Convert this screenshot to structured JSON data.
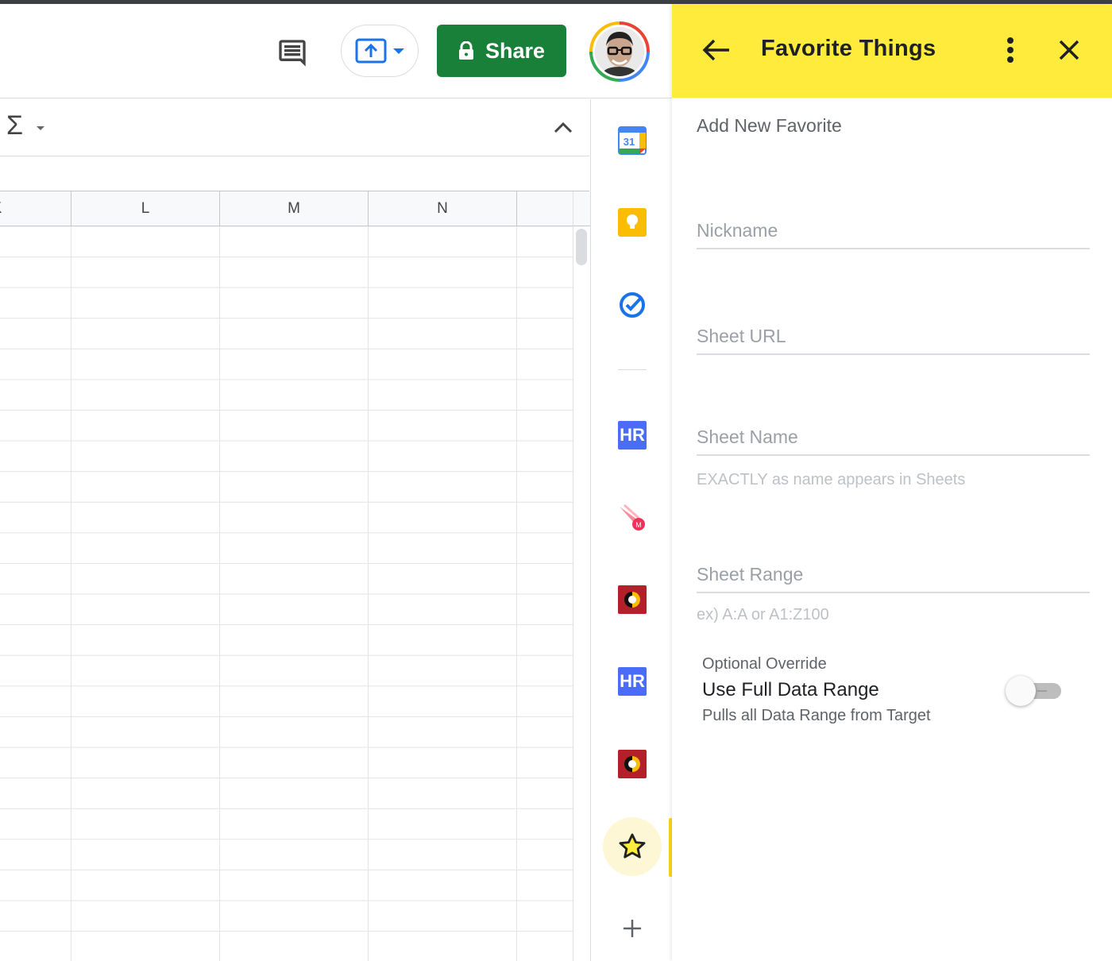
{
  "header": {
    "share_label": "Share",
    "share_color": "#188038"
  },
  "grid": {
    "columns": [
      "K",
      "L",
      "M",
      "N"
    ]
  },
  "rail": {
    "items": [
      {
        "icon": "calendar-icon",
        "text": "31"
      },
      {
        "icon": "keep-icon"
      },
      {
        "icon": "tasks-icon"
      },
      {
        "icon": "hr-addon-icon",
        "text": "HR"
      },
      {
        "icon": "meteor-addon-icon"
      },
      {
        "icon": "red-addon-icon"
      },
      {
        "icon": "hr-addon-icon",
        "text": "HR"
      },
      {
        "icon": "red-addon-icon"
      },
      {
        "icon": "star-icon",
        "active": true
      },
      {
        "icon": "plus-icon"
      }
    ]
  },
  "panel": {
    "title": "Favorite Things",
    "header_color": "#ffeb3b",
    "section_title": "Add New Favorite",
    "fields": {
      "nickname_placeholder": "Nickname",
      "sheet_url_placeholder": "Sheet URL",
      "sheet_name_placeholder": "Sheet Name",
      "sheet_name_hint": "EXACTLY as name appears in Sheets",
      "sheet_range_placeholder": "Sheet Range",
      "sheet_range_hint": "ex) A:A or A1:Z100"
    },
    "override": {
      "label": "Optional Override",
      "title": "Use Full Data Range",
      "description": "Pulls all Data Range from Target",
      "enabled": false
    }
  }
}
